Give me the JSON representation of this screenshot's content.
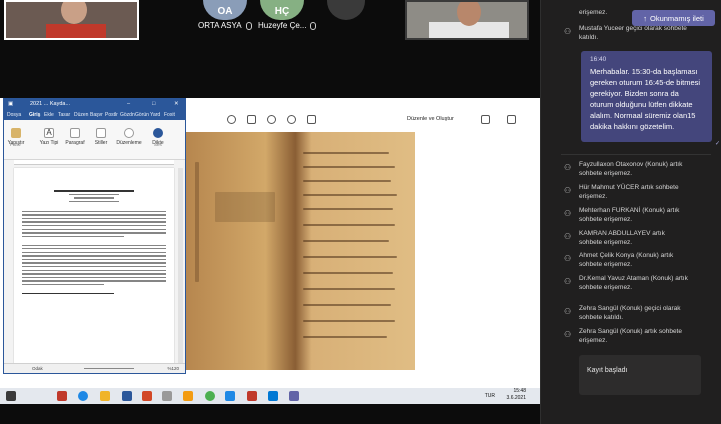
{
  "participants": {
    "tiles": [
      {
        "label": "ORTA ASYA",
        "initials": "OA",
        "color": "#8a9db8"
      },
      {
        "label": "Huzeyfe Çe...",
        "initials": "HÇ",
        "color": "#86b083"
      }
    ]
  },
  "word": {
    "title": "2021 ... Kayda...",
    "tabs": [
      "Dosya",
      "Giriş",
      "Ekle",
      "Tasar",
      "Düzen",
      "Başvr",
      "Postlr",
      "Gözdn",
      "Görün",
      "Yard",
      "Foxit"
    ],
    "ribbon": {
      "paste_label": "Yapıştır",
      "font_label": "Yazı Tipi",
      "paragraph_label": "Paragraf",
      "styles_label": "Stiller",
      "editing_label": "Düzenleme",
      "voice_label": "Dikte",
      "group_labels": [
        "Pano",
        "Ses"
      ]
    },
    "status": {
      "left": "Odak",
      "zoom": "%120"
    }
  },
  "photos": {
    "edit_label": "Düzenle ve Oluştur"
  },
  "taskbar": {
    "lang": "TUR",
    "time": "15:48",
    "date": "3.6.2021"
  },
  "chat": {
    "top_event": "erişemez.",
    "guest_joined": "Mustafa Yuceer geçici olarak sohbete katıldı.",
    "unread_button": "Okunmamış ileti",
    "message": {
      "time": "16:40",
      "text": "Merhabalar. 15:30-da başlaması gereken oturum 16:45-de bitmesi gerekiyor. Bizden sonra da oturum olduğunu lütfen dikkate alalım. Normaal süremiz olan15 dakika hakkını gözetelim."
    },
    "events": [
      "Fayzullaxon Otaxonov (Konuk) artık sohbete erişemez.",
      "Hür Mahmut YÜCER artık sohbete erişemez.",
      "Mehterhan FURKANİ (Konuk) artık sohbete erişemez.",
      "KAMRAN ABDULLAYEV artık sohbete erişemez.",
      "Ahmet Çelik Konya (Konuk) artık sohbete erişemez.",
      "Dr.Kemal Yavuz Ataman (Konuk) artık sohbete erişemez.",
      "Zehra Sangül (Konuk) geçici olarak sohbete katıldı.",
      "Zehra Sangül (Konuk) artık sohbete erişemez."
    ],
    "recording": "Kayıt başladı"
  }
}
